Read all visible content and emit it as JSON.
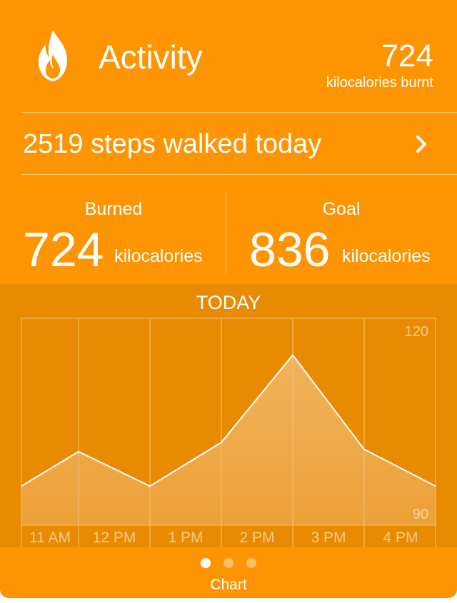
{
  "header": {
    "title": "Activity",
    "icon": "flame-icon",
    "value": "724",
    "unit": "kilocalories burnt"
  },
  "steps": {
    "text": "2519 steps walked today",
    "chevron_icon": "chevron-right-icon"
  },
  "stats": {
    "burned": {
      "label": "Burned",
      "value": "724",
      "unit": "kilocalories"
    },
    "goal": {
      "label": "Goal",
      "value": "836",
      "unit": "kilocalories"
    }
  },
  "chart_data": {
    "type": "area",
    "title": "TODAY",
    "x": [
      "",
      "11 AM",
      "12 PM",
      "1 PM",
      "2 PM",
      "3 PM",
      "4 PM"
    ],
    "categories": [
      "11 AM",
      "12 PM",
      "1 PM",
      "2 PM",
      "3 PM",
      "4 PM"
    ],
    "values": [
      98.5,
      106,
      98.5,
      108,
      127,
      106.5,
      98.5
    ],
    "y_tick_labels": [
      "120",
      "90"
    ],
    "ylim": [
      90,
      135
    ],
    "grid": true,
    "colors": {
      "line": "#ffffff",
      "fill_top": "#f2b35a",
      "fill_bottom": "#eda038",
      "grid": "#f5c07a"
    }
  },
  "footer": {
    "label": "Chart",
    "page_count": 3,
    "active_page": 0
  },
  "colors": {
    "background": "#fd9502",
    "panel": "#e88b00"
  }
}
